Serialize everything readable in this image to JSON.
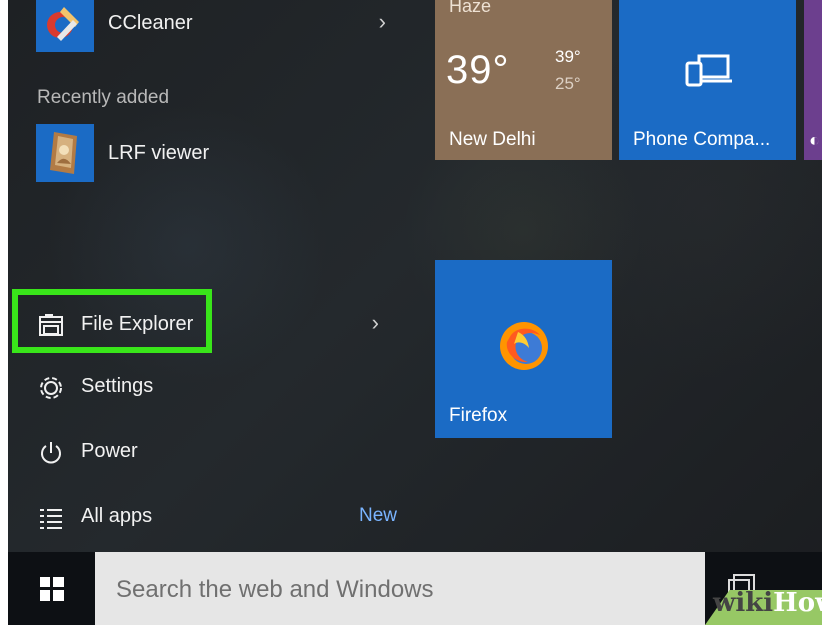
{
  "start_menu": {
    "apps": {
      "ccleaner": {
        "label": "CCleaner"
      },
      "recently_added_title": "Recently added",
      "lrf_viewer": {
        "label": "LRF viewer"
      }
    },
    "nav": {
      "file_explorer": "File Explorer",
      "settings": "Settings",
      "power": "Power",
      "all_apps": "All apps",
      "all_apps_badge": "New"
    }
  },
  "tiles": {
    "weather": {
      "condition": "Haze",
      "temperature": "39°",
      "high": "39°",
      "low": "25°",
      "city": "New Delhi"
    },
    "phone": {
      "label": "Phone Compa..."
    },
    "firefox": {
      "label": "Firefox"
    }
  },
  "taskbar": {
    "search_placeholder": "Search the web and Windows"
  },
  "watermark": {
    "wiki": "wiki",
    "how": "How"
  },
  "icons": {
    "ccleaner": "ccleaner-icon",
    "lrf_viewer": "lrf-viewer-icon",
    "file_explorer": "file-explorer-icon",
    "settings": "gear-icon",
    "power": "power-icon",
    "all_apps": "list-icon",
    "phone": "phone-laptop-icon",
    "firefox": "firefox-icon",
    "windows": "windows-logo-icon",
    "task_view": "task-view-icon"
  },
  "colors": {
    "highlight": "#39e51a",
    "tile_blue": "#1b6bc5",
    "weather_tile": "#8a6f56",
    "new_badge": "#7ab4ff"
  }
}
